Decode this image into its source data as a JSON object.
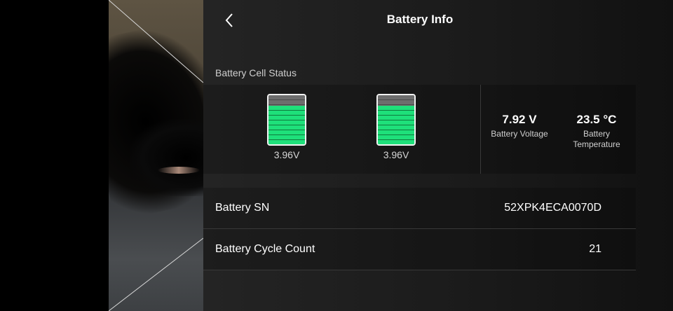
{
  "header": {
    "title": "Battery Info",
    "back_icon": "chevron-left-icon"
  },
  "cell_status": {
    "section_label": "Battery Cell Status",
    "cells": [
      {
        "voltage": "3.96V"
      },
      {
        "voltage": "3.96V"
      }
    ]
  },
  "stats": {
    "voltage": {
      "value": "7.92 V",
      "label": "Battery Voltage"
    },
    "temperature": {
      "value": "23.5 °C",
      "label": "Battery Temperature"
    }
  },
  "info": {
    "serial": {
      "label": "Battery SN",
      "value": "52XPK4ECA0070D"
    },
    "cycle": {
      "label": "Battery Cycle Count",
      "value": "21"
    }
  },
  "colors": {
    "cell_fill": "#1ee07a",
    "panel_bg": "#1e1e1e",
    "text": "#ffffff"
  }
}
